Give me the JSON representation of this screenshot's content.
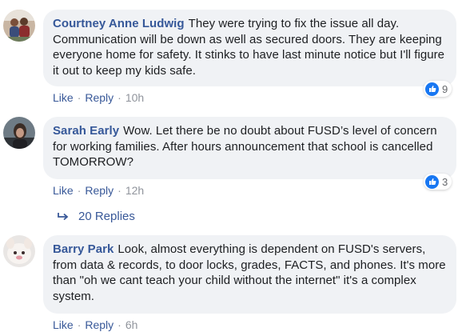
{
  "comments": [
    {
      "author": "Courtney Anne Ludwig",
      "text": "They were trying to fix the issue all day. Communication will be down as well as secured doors. They are keeping everyone home for safety. It stinks to have last minute notice but I'll figure it out to keep my kids safe.",
      "like_label": "Like",
      "reply_label": "Reply",
      "time": "10h",
      "reaction_count": "9"
    },
    {
      "author": "Sarah Early",
      "text": "Wow. Let there be no doubt about FUSD’s level of concern for working families. After hours announcement that school is cancelled TOMORROW?",
      "like_label": "Like",
      "reply_label": "Reply",
      "time": "12h",
      "reaction_count": "3"
    },
    {
      "author": "Barry Park",
      "text": "Look, almost everything is dependent on FUSD's servers, from data & records, to door locks, grades, FACTS, and phones. It's more than \"oh we cant teach your child without the internet\" it's a complex system.",
      "like_label": "Like",
      "reply_label": "Reply",
      "time": "6h"
    }
  ],
  "replies_link": {
    "label": "20 Replies",
    "icon": "reply-arrow-icon"
  },
  "colors": {
    "author_link": "#365899",
    "action_link": "#385898",
    "bubble_bg": "#f0f2f5",
    "like_badge": "#1877f2",
    "meta_gray": "#90949c"
  }
}
